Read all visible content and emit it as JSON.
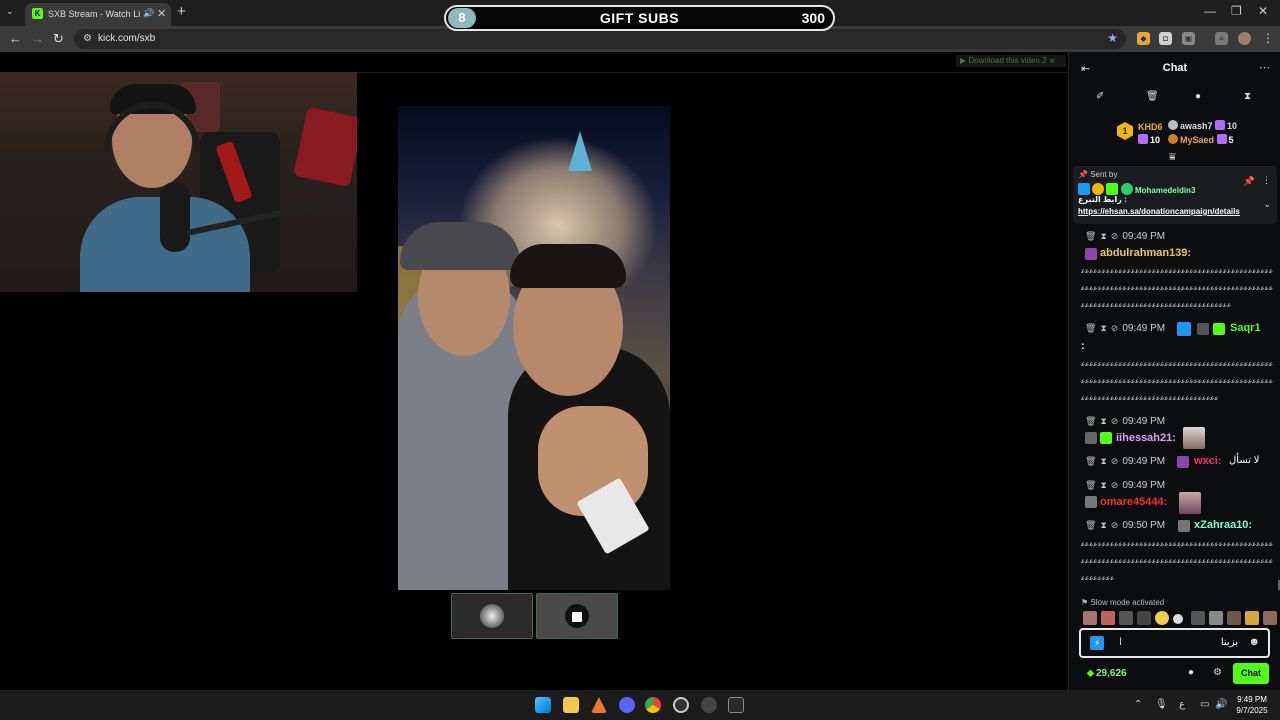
{
  "browser": {
    "tab_title": "SXB Stream - Watch Live on",
    "tab_favicon": "K",
    "url": "kick.com/sxb",
    "download_hint": "▶ Download this video",
    "download_hint_extra": "2 ⨯"
  },
  "overlay": {
    "gift_count": "8",
    "gift_label": "GIFT SUBS",
    "gift_goal": "300"
  },
  "chat": {
    "title": "Chat",
    "top_gifters": {
      "first": {
        "rank": "1",
        "name": "KHD6",
        "count": "10"
      },
      "second": {
        "name": "awash7",
        "count": "10"
      },
      "third": {
        "name": "MySaed",
        "count": "5"
      }
    },
    "pinned": {
      "sent_by_label": "Sent by",
      "sender": "Mohamedeldin3",
      "message": "رابط التبرع :",
      "link": "https://ehsan.sa/donationcampaign/details"
    },
    "messages": [
      {
        "time": "09:49 PM",
        "user": "abdulrahman139:",
        "user_color": "#f2c94c"
      },
      {
        "time": "09:49 PM",
        "user": "Saqr1",
        "user_color": "#53fc18",
        "colon": ":"
      },
      {
        "time": "09:49 PM",
        "user": "iihessah21:",
        "user_color": "#e0a0ff"
      },
      {
        "time": "09:49 PM",
        "user": "wxci:",
        "user_color": "#ff2a6d",
        "text": "لا تسأل"
      },
      {
        "time": "09:49 PM",
        "user": "omare45444:",
        "user_color": "#ff2a2a"
      },
      {
        "time": "09:50 PM",
        "user": "xZahraa10:",
        "user_color": "#7fffd4"
      }
    ],
    "spam_line": "ﻋﻋﻋﻋﻋﻋﻋﻋﻋﻋﻋﻋﻋﻋﻋﻋﻋﻋﻋﻋﻋﻋﻋﻋﻋﻋﻋﻋﻋﻋﻋﻋﻋﻋﻋﻋﻋﻋﻋﻋﻋﻋﻋﻋﻋﻋﻋﻋ",
    "spam_short_1": "ﻋﻋﻋﻋﻋﻋﻋﻋﻋﻋﻋﻋﻋﻋﻋﻋﻋﻋﻋﻋﻋﻋﻋﻋﻋﻋﻋﻋﻋﻋﻋﻋﻋﻋﻋﻋ",
    "spam_short_2": "ﻋﻋﻋﻋﻋﻋﻋﻋﻋﻋﻋﻋﻋﻋﻋﻋﻋﻋﻋﻋﻋﻋﻋﻋﻋﻋﻋﻋﻋﻋﻋﻋﻋ",
    "spam_short_3": "ﻋﻋﻋﻋﻋﻋﻋﻋ",
    "slow_mode": "Slow mode activated",
    "input_value": "بزبنا",
    "points": "29,626",
    "send_label": "Chat"
  },
  "taskbar": {
    "time": "9:49 PM",
    "date": "9/7/2025",
    "lang": "ع"
  }
}
